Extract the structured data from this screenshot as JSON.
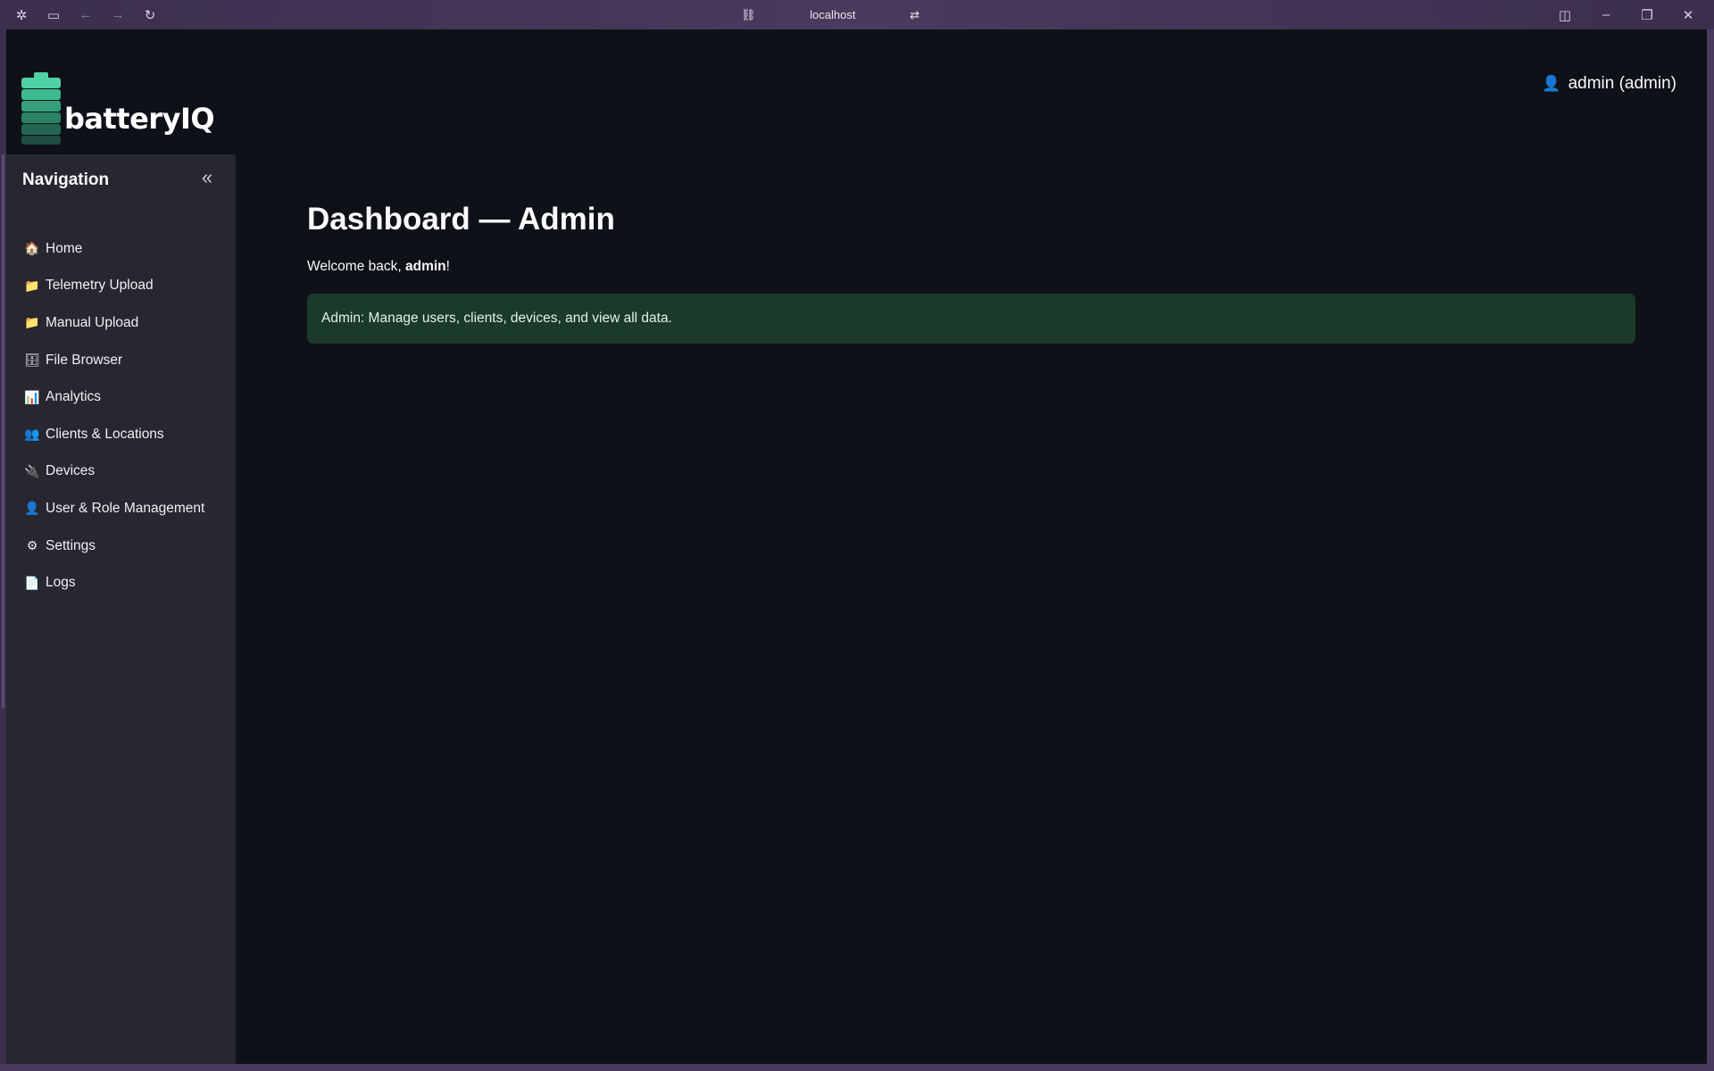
{
  "browser": {
    "url": "localhost"
  },
  "brand": {
    "logo_text": "batteryIQ",
    "accent": "#4fd1a5"
  },
  "sidebar": {
    "header": "Navigation",
    "items": [
      {
        "icon": "house-icon",
        "glyph": "🏠",
        "label": "Home"
      },
      {
        "icon": "folder-icon",
        "glyph": "📁",
        "label": "Telemetry Upload"
      },
      {
        "icon": "folder-icon",
        "glyph": "📁",
        "label": "Manual Upload"
      },
      {
        "icon": "file-cabinet-icon",
        "glyph": "🗄",
        "label": "File Browser"
      },
      {
        "icon": "bar-chart-icon",
        "glyph": "📊",
        "label": "Analytics"
      },
      {
        "icon": "people-icon",
        "glyph": "👥",
        "label": "Clients & Locations"
      },
      {
        "icon": "plug-icon",
        "glyph": "🔌",
        "label": "Devices"
      },
      {
        "icon": "person-icon",
        "glyph": "👤",
        "label": "User & Role Management"
      },
      {
        "icon": "gear-icon",
        "glyph": "⚙",
        "label": "Settings"
      },
      {
        "icon": "page-icon",
        "glyph": "📄",
        "label": "Logs"
      }
    ]
  },
  "user": {
    "label": "admin (admin)"
  },
  "main": {
    "title": "Dashboard — Admin",
    "welcome_prefix": "Welcome back, ",
    "welcome_name": "admin",
    "welcome_suffix": "!",
    "info_text": "Admin: Manage users, clients, devices, and view all data.",
    "info_bg": "#1b3a2a"
  }
}
